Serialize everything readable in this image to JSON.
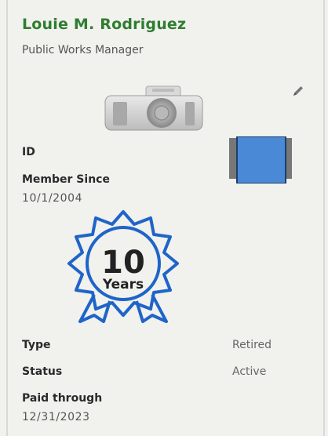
{
  "member": {
    "name": "Louie M. Rodriguez",
    "title": "Public Works Manager"
  },
  "icons": {
    "photo": "camera-icon",
    "edit": "pencil-icon",
    "id_card": "id-card-icon",
    "badge": "award-ribbon-icon"
  },
  "fields": {
    "id_label": "ID",
    "member_since_label": "Member Since",
    "member_since_value": "10/1/2004",
    "type_label": "Type",
    "type_value": "Retired",
    "status_label": "Status",
    "status_value": "Active",
    "paid_through_label": "Paid through",
    "paid_through_value": "12/31/2023"
  },
  "badge": {
    "number": "10",
    "unit": "Years"
  },
  "colors": {
    "name": "#2f7d2f",
    "badge_blue": "#1f64c8",
    "id_card_blue": "#4a89d6"
  }
}
